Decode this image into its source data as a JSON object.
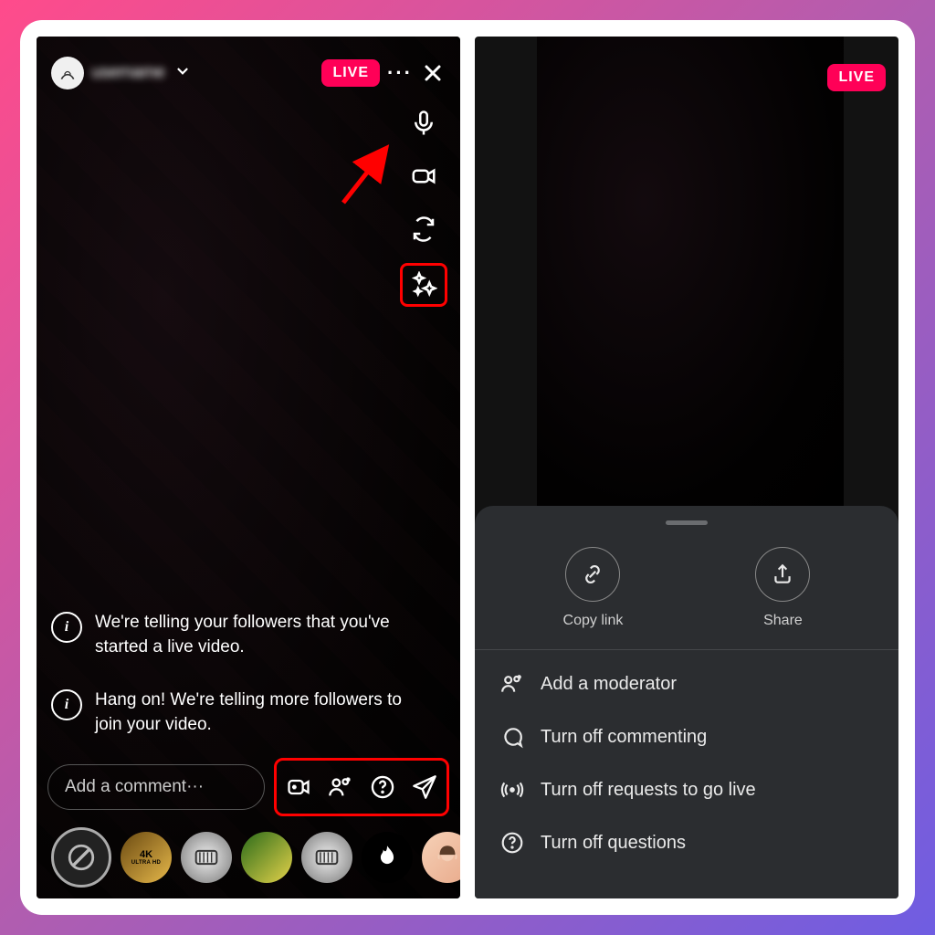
{
  "left": {
    "username": "username",
    "live_label": "LIVE",
    "sys_messages": [
      "We're telling your followers that you've started a live video.",
      "Hang on! We're telling more followers to join your video."
    ],
    "comment_placeholder": "Add a comment···",
    "filters": [
      "none",
      "4k",
      "silver-hd",
      "gold",
      "silver-hd-2",
      "flame",
      "face"
    ]
  },
  "right": {
    "live_label": "LIVE",
    "share": {
      "copy": "Copy link",
      "share": "Share"
    },
    "menu": [
      "Add a moderator",
      "Turn off commenting",
      "Turn off requests to go live",
      "Turn off questions"
    ]
  }
}
